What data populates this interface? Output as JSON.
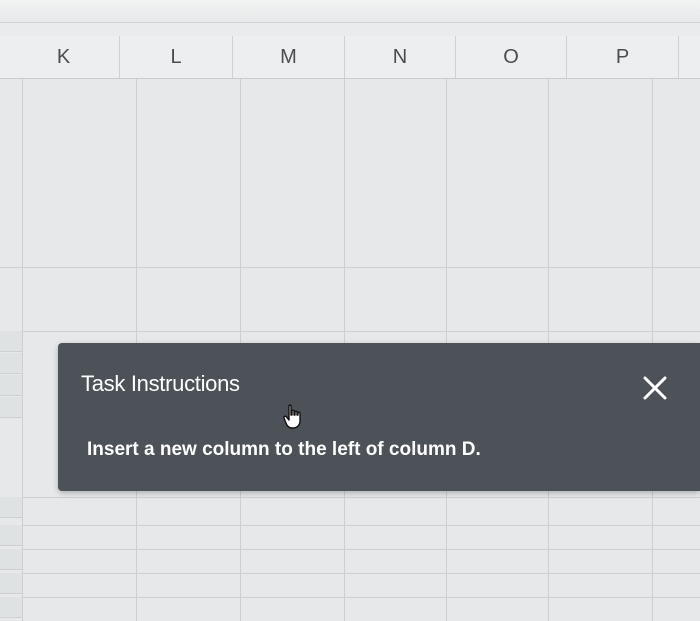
{
  "spreadsheet": {
    "column_headers": [
      "K",
      "L",
      "M",
      "N",
      "O",
      "P"
    ]
  },
  "task_dialog": {
    "title": "Task Instructions",
    "instruction": "Insert a new column to the left of column D.",
    "close_icon": "close-icon",
    "background_color": "#4c5257",
    "text_color": "#ffffff"
  },
  "cursor": {
    "icon": "hand-pointer-icon"
  }
}
